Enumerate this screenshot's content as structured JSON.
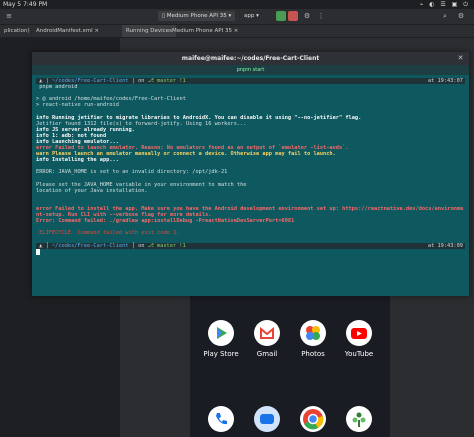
{
  "topbar": {
    "date": "May 5",
    "time": "7:49 PM"
  },
  "ide": {
    "device_selector": "Medium Phone API 35",
    "app_selector": "app",
    "tabs": [
      "plication)",
      "AndroidManifest.xml",
      "Running Devices",
      "Medium Phone API 35"
    ]
  },
  "terminal": {
    "window_title": "maifee@maifee:~/codes/Free-Cart-Client",
    "tab_label": "pnpm start",
    "prompt1": {
      "dir": "~/codes/Free-Cart-Client",
      "git": "master",
      "status": "!1",
      "time": "at 19:43:07"
    },
    "lines": [
      " pnpm android",
      "",
      "> @ android /home/maifee/codes/Free-Cart-Client",
      "> react-native run-android",
      "",
      "info Running jetifier to migrate libraries to AndroidX. You can disable it using \"--no-jetifier\" flag.",
      "Jetifier found 1312 file(s) to forward-jetify. Using 16 workers...",
      "info JS server already running.",
      "info 1: adb: not found",
      "info Launching emulator...",
      "error Failed to launch emulator. Reason: No emulators found as an output of `emulator -list-avds`.",
      "warn Please launch an emulator manually or connect a device. Otherwise app may fail to launch.",
      "info Installing the app...",
      "",
      "ERROR: JAVA_HOME is set to an invalid directory: /opt/jdk-21",
      "",
      "Please set the JAVA_HOME variable in your environment to match the",
      "location of your Java installation.",
      "",
      "",
      "error Failed to install the app. Make sure you have the Android development environment set up: https://reactnative.dev/docs/environme",
      "nt-setup. Run CLI with --verbose flag for more details.",
      "Error: Command failed: ./gradlew app:installDebug -PreactNativeDevServerPort=8081",
      "",
      " ELIFECYCLE  Command failed with exit code 1."
    ],
    "prompt2": {
      "dir": "~/codes/Free-Cart-Client",
      "git": "master",
      "status": "!1",
      "time": "at 19:43:09"
    }
  },
  "emulator": {
    "apps": [
      {
        "label": "Play Store",
        "icon": "play-store-icon"
      },
      {
        "label": "Gmail",
        "icon": "gmail-icon"
      },
      {
        "label": "Photos",
        "icon": "photos-icon"
      },
      {
        "label": "YouTube",
        "icon": "youtube-icon"
      }
    ],
    "dock": [
      "phone-icon",
      "messages-icon",
      "chrome-icon",
      "app-icon"
    ]
  }
}
